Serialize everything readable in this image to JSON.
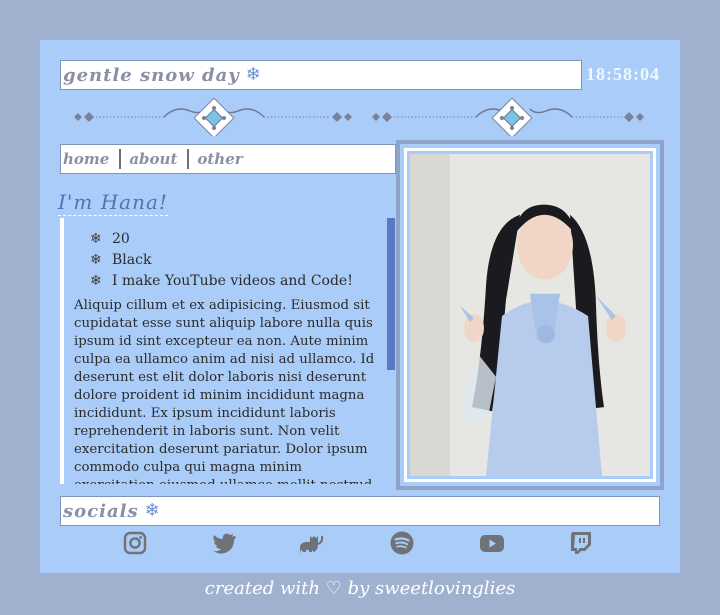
{
  "header": {
    "title": "gentle snow day",
    "title_icon": "snowflake-icon",
    "clock": "18:58:04"
  },
  "nav": {
    "items": [
      {
        "label": "home"
      },
      {
        "label": "about"
      },
      {
        "label": "other"
      }
    ]
  },
  "profile": {
    "heading": "I'm Hana!",
    "facts": [
      "20",
      "Black",
      "I make YouTube videos and Code!"
    ],
    "bullet_icon": "snowflake-icon",
    "bio": "Aliquip cillum et ex adipisicing. Eiusmod sit cupidatat esse sunt aliquip labore nulla quis ipsum id sint excepteur ea non. Aute minim culpa ea ullamco anim ad nisi ad ullamco. Id deserunt est elit dolor laboris nisi deserunt dolore proident id minim incididunt magna incididunt. Ex ipsum incididunt laboris reprehenderit in laboris sunt. Non velit exercitation deserunt pariatur. Dolor ipsum commodo culpa qui magna minim exercitation eiusmod ullamco mollit nostrud."
  },
  "photo": {
    "description": "photo-portrait"
  },
  "socials": {
    "label": "socials",
    "icons": [
      "instagram-icon",
      "twitter-icon",
      "cat-icon",
      "spotify-icon",
      "youtube-icon",
      "twitch-icon"
    ]
  },
  "footer": {
    "text_before": "created with",
    "text_after": "by sweetlovinglies"
  },
  "colors": {
    "background": "#9fb1cf",
    "panel": "#a9cdf8",
    "accent": "#5a78c4",
    "icon_gray": "#6f7278"
  }
}
